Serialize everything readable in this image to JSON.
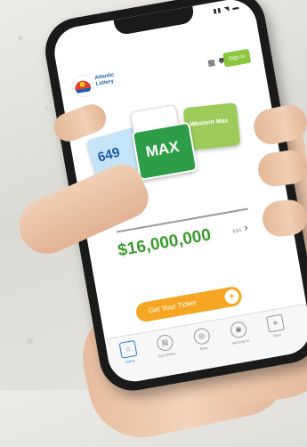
{
  "app": {
    "brand": "Atlantic Lottery",
    "signin_label": "Sign in"
  },
  "games": [
    {
      "label": "649",
      "color": "#c6e4f7"
    },
    {
      "label": "MAX",
      "color": "#2e9d48"
    },
    {
      "label": "Western Max",
      "color": "#9ccb5a"
    }
  ],
  "jackpot": {
    "amount": "$16,000,000",
    "unit": "EST."
  },
  "cta": {
    "label": "Get Your Ticket"
  },
  "tabs": [
    {
      "label": "Home",
      "active": true
    },
    {
      "label": "Buy Online"
    },
    {
      "label": "Scan"
    },
    {
      "label": "Winning #s"
    },
    {
      "label": "More"
    }
  ]
}
